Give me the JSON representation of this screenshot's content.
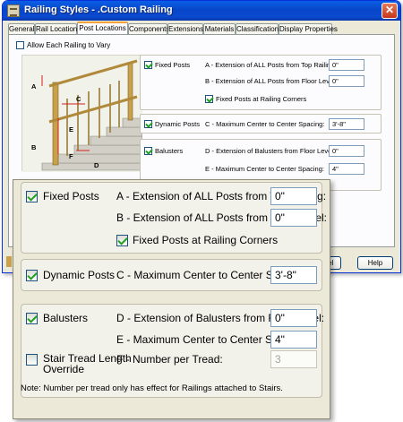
{
  "window": {
    "title": "Railing Styles - .Custom Railing",
    "close_glyph": "✕"
  },
  "tabs": [
    {
      "label": "General"
    },
    {
      "label": "Rail Locations"
    },
    {
      "label": "Post Locations",
      "active": true
    },
    {
      "label": "Components"
    },
    {
      "label": "Extensions"
    },
    {
      "label": "Materials"
    },
    {
      "label": "Classifications"
    },
    {
      "label": "Display Properties"
    }
  ],
  "allow_vary": {
    "label": "Allow Each Railing to Vary",
    "checked": false
  },
  "fixed_posts": {
    "label": "Fixed Posts",
    "checked": true,
    "a_label": "A - Extension of ALL Posts from Top Railing:",
    "a_value": "0\"",
    "b_label": "B - Extension of ALL Posts from Floor Level:",
    "b_value": "0\"",
    "corners_label": "Fixed Posts at Railing Corners",
    "corners_checked": true
  },
  "dynamic_posts": {
    "label": "Dynamic Posts",
    "checked": true,
    "c_label": "C - Maximum Center to Center Spacing:",
    "c_value": "3'-8\""
  },
  "balusters": {
    "label": "Balusters",
    "checked": true,
    "d_label": "D - Extension of Balusters from Floor Level:",
    "d_value": "0\"",
    "e_label": "E - Maximum Center to Center Spacing:",
    "e_value": "4\""
  },
  "stair_tread": {
    "label_line1": "Stair Tread Length",
    "label_line2": "Override",
    "checked": false,
    "f_label": "F - Number per Tread:",
    "f_value": "3"
  },
  "note": "Note: Number per tread only has effect for Railings attached to Stairs.",
  "illustration": {
    "labels": {
      "a": "A",
      "b": "B",
      "c": "C",
      "d": "D",
      "e": "E",
      "f": "F"
    },
    "rail_color": "#c9a14a",
    "callout_color": "#d42020"
  },
  "buttons": {
    "cancel_partial": "ncel",
    "help": "Help"
  }
}
